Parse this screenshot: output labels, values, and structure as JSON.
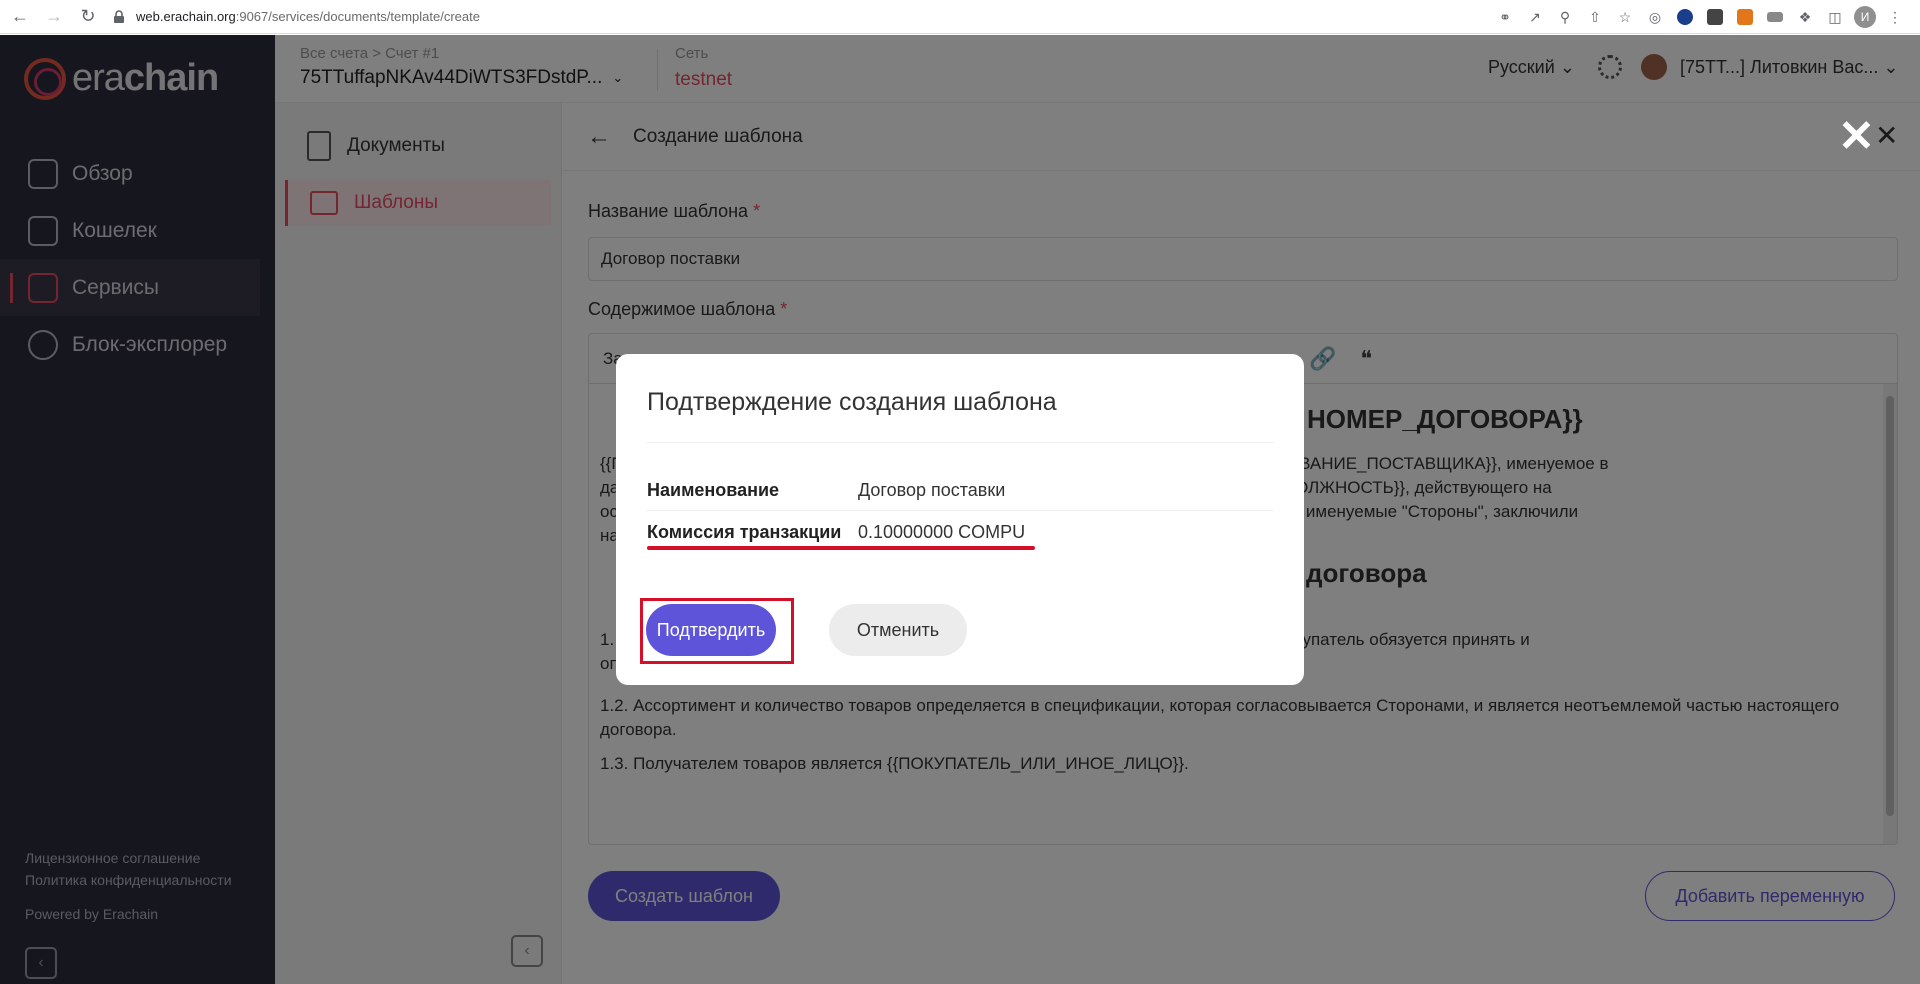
{
  "browser": {
    "url_host": "web.erachain.org",
    "url_path": ":9067/services/documents/template/create",
    "profile_initial": "И"
  },
  "sidebar": {
    "logo_text_a": "era",
    "logo_text_b": "chain",
    "items": [
      {
        "label": "Обзор",
        "icon": "monitor-icon"
      },
      {
        "label": "Кошелек",
        "icon": "wallet-icon"
      },
      {
        "label": "Сервисы",
        "icon": "grid-icon"
      },
      {
        "label": "Блок-эксплорер",
        "icon": "compass-icon"
      }
    ],
    "footer": {
      "license": "Лицензионное соглашение",
      "privacy": "Политика конфиденциальности",
      "powered": "Powered by Erachain"
    }
  },
  "topbar": {
    "breadcrumb": "Все счета > Счет #1",
    "account": "75TTuffapNKAv44DiWTS3FDstdP...",
    "network_label": "Сеть",
    "network_value": "testnet",
    "language": "Русский",
    "user": "[75TT...] Литовкин Вас..."
  },
  "subnav": {
    "items": [
      {
        "label": "Документы"
      },
      {
        "label": "Шаблоны"
      }
    ]
  },
  "page": {
    "title": "Создание шаблона",
    "name_label": "Название шаблона",
    "required_mark": "*",
    "name_value": "Договор поставки",
    "content_label": "Содержимое шаблона",
    "toolbar_first": "За",
    "doc_heading_1": "НОМЕР_ДОГОВОРА}}",
    "doc_p1_l1": "{{П                                                                                                 щего на основании {{ОСНОВАНИЕ_ПОСТАВЩИКА}}, именуемое в",
    "doc_p1_l2": "да                                                                                                 це {{ФИО_ПОКУПАТЕЛЯ_ДОЛЖНОСТЬ}}, действующего на",
    "doc_p1_l3": "ос                                                                                                 , с другой стороны, а вместе именуемые \"Стороны\", заключили",
    "doc_p1_l4": "на",
    "doc_heading_2": "договора",
    "doc_p2_l1": "1.                                                                                                  щим договором сроки, а Покупатель обязуется принять и",
    "doc_p2_l2": "оп",
    "doc_p3": "1.2. Ассортимент и количество товаров определяется в спецификации, которая согласовывается Сторонами, и является неотъемлемой частью настоящего договора.",
    "doc_p4": "1.3. Получателем товаров является {{ПОКУПАТЕЛЬ_ИЛИ_ИНОЕ_ЛИЦО}}.",
    "create_button": "Создать шаблон",
    "add_var_button": "Добавить переменную"
  },
  "modal": {
    "title": "Подтверждение создания шаблона",
    "rows": [
      {
        "label": "Наименование",
        "value": "Договор поставки"
      },
      {
        "label": "Комиссия транзакции",
        "value": "0.10000000 COMPU"
      }
    ],
    "confirm": "Подтвердить",
    "cancel": "Отменить"
  },
  "colors": {
    "accent": "#5e54d9",
    "brand_red": "#e84a5f",
    "annotation_red": "#d40f2a",
    "sidebar_bg": "#2d2c3c"
  }
}
